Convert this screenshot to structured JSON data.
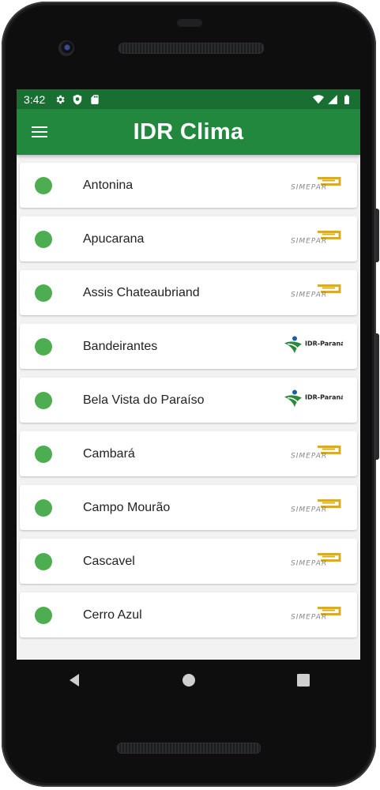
{
  "status_bar": {
    "time": "3:42",
    "left_icons": [
      "gear-icon",
      "shield-icon",
      "sd-card-icon"
    ],
    "right_icons": [
      "wifi-icon",
      "signal-icon",
      "battery-icon"
    ],
    "color": "#196f32"
  },
  "app_bar": {
    "title": "IDR Clima",
    "color": "#21883e"
  },
  "stations": [
    {
      "name": "Antonina",
      "source": "simepar",
      "status_color": "#4cae50"
    },
    {
      "name": "Apucarana",
      "source": "simepar",
      "status_color": "#4cae50"
    },
    {
      "name": "Assis Chateaubriand",
      "source": "simepar",
      "status_color": "#4cae50"
    },
    {
      "name": "Bandeirantes",
      "source": "idr-parana",
      "status_color": "#4cae50"
    },
    {
      "name": "Bela Vista do Paraíso",
      "source": "idr-parana",
      "status_color": "#4cae50"
    },
    {
      "name": "Cambará",
      "source": "simepar",
      "status_color": "#4cae50"
    },
    {
      "name": "Campo Mourão",
      "source": "simepar",
      "status_color": "#4cae50"
    },
    {
      "name": "Cascavel",
      "source": "simepar",
      "status_color": "#4cae50"
    },
    {
      "name": "Cerro Azul",
      "source": "simepar",
      "status_color": "#4cae50"
    }
  ],
  "logos": {
    "simepar_text": "SIMEPAR",
    "idr_text": "IDR-Paraná"
  },
  "nav_bar": [
    "back-icon",
    "home-icon",
    "recents-icon"
  ]
}
